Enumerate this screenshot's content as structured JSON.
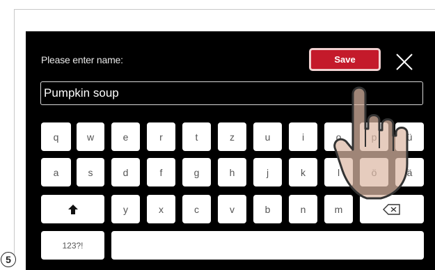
{
  "dialog": {
    "prompt": "Please enter name:",
    "save_label": "Save",
    "name_value": "Pumpkin soup"
  },
  "keyboard": {
    "row1": [
      "q",
      "w",
      "e",
      "r",
      "t",
      "z",
      "u",
      "i",
      "o",
      "p",
      "ü"
    ],
    "row2": [
      "a",
      "s",
      "d",
      "f",
      "g",
      "h",
      "j",
      "k",
      "l",
      "ö",
      "ä"
    ],
    "row3": [
      "y",
      "x",
      "c",
      "v",
      "b",
      "n",
      "m"
    ],
    "numbers_label": "123?!",
    "space_label": ""
  },
  "step_number": "5",
  "colors": {
    "save_button": "#c41a2b",
    "screen_background": "#000000",
    "key_background": "#ffffff"
  }
}
